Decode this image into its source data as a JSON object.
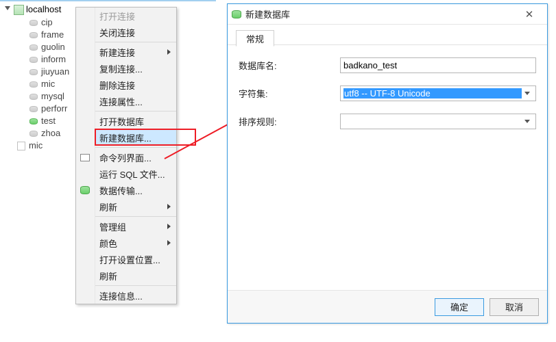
{
  "tree": {
    "root": "localhost",
    "items": [
      "cip",
      "frame",
      "guolin",
      "inform",
      "jiuyuan",
      "mic",
      "mysql",
      "perforr",
      "test",
      "zhoa"
    ],
    "mic": "mic"
  },
  "menu": {
    "open_conn": "打开连接",
    "close_conn": "关闭连接",
    "new_conn": "新建连接",
    "dup_conn": "复制连接...",
    "del_conn": "删除连接",
    "conn_props": "连接属性...",
    "open_db": "打开数据库",
    "new_db": "新建数据库...",
    "cli": "命令列界面...",
    "run_sql": "运行 SQL 文件...",
    "data_transfer": "数据传输...",
    "refresh1": "刷新",
    "manage_group": "管理组",
    "color": "颜色",
    "open_settings_loc": "打开设置位置...",
    "refresh2": "刷新",
    "conn_info": "连接信息..."
  },
  "dialog": {
    "title": "新建数据库",
    "tab_general": "常规",
    "lbl_db_name": "数据库名:",
    "lbl_charset": "字符集:",
    "lbl_collation": "排序规则:",
    "db_name_value": "badkano_test",
    "charset_value": "utf8 -- UTF-8 Unicode",
    "collation_value": "",
    "ok": "确定",
    "cancel": "取消"
  }
}
